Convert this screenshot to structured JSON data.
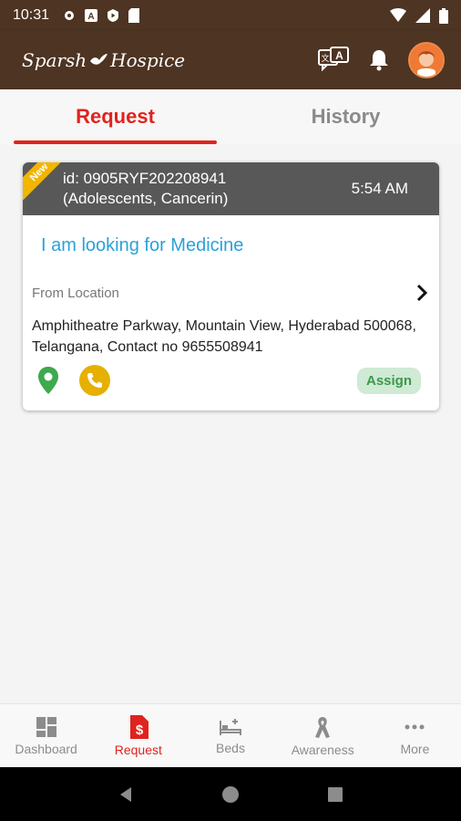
{
  "status_bar": {
    "time": "10:31"
  },
  "app": {
    "logo_left": "Sparsh",
    "logo_right": "Hospice"
  },
  "tabs": [
    {
      "label": "Request",
      "active": true
    },
    {
      "label": "History",
      "active": false
    }
  ],
  "request_card": {
    "ribbon": "New",
    "id_line": "id: 0905RYF202208941",
    "category_line": "(Adolescents, Cancerin)",
    "time": "5:54 AM",
    "title": "I am looking for Medicine",
    "location_label": "From Location",
    "address": "Amphitheatre Parkway, Mountain View, Hyderabad 500068, Telangana, Contact no 9655508941",
    "assign_label": "Assign"
  },
  "bottom_nav": [
    {
      "label": "Dashboard",
      "icon": "dashboard-icon",
      "active": false
    },
    {
      "label": "Request",
      "icon": "request-icon",
      "active": true
    },
    {
      "label": "Beds",
      "icon": "bed-icon",
      "active": false
    },
    {
      "label": "Awareness",
      "icon": "ribbon-icon",
      "active": false
    },
    {
      "label": "More",
      "icon": "more-icon",
      "active": false
    }
  ],
  "colors": {
    "brand_brown": "#4e3422",
    "accent_red": "#e0231e",
    "title_blue": "#2aa1d8",
    "ribbon_yellow": "#f2b600",
    "assign_green": "#3a9a4a"
  }
}
